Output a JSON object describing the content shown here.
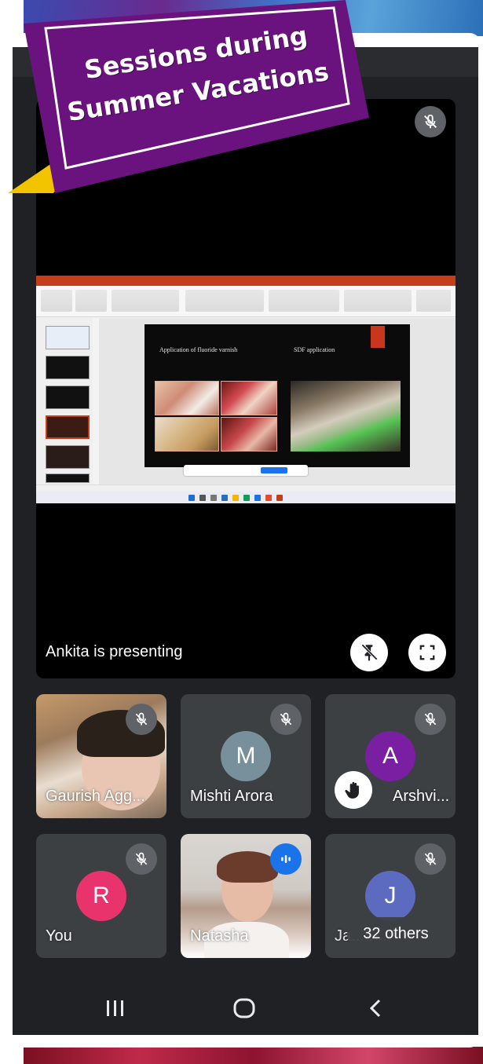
{
  "banner": {
    "line1": "Sessions during",
    "line2": "Summer Vacations"
  },
  "meet": {
    "presenter_label": "Ankita is presenting",
    "buttons": {
      "mic_off": "mic-off-icon",
      "unpin": "unpin-icon",
      "fullscreen": "fullscreen-icon"
    },
    "shared_slide": {
      "title_left": "Application of fluoride varnish",
      "title_right": "SDF application"
    },
    "participants": [
      {
        "name": "Gaurish Agg...",
        "type": "video",
        "muted": true
      },
      {
        "name": "Mishti Arora",
        "initial": "M",
        "avatar_color": "#78909c",
        "muted": true
      },
      {
        "name": "Arshvi...",
        "initial": "A",
        "avatar_color": "#7b1fa2",
        "muted": true,
        "hand_raised": true
      },
      {
        "name": "You",
        "initial": "R",
        "avatar_color": "#e8336d",
        "muted": true
      },
      {
        "name": "Natasha",
        "type": "video",
        "speaking": true
      },
      {
        "name": "Ja...Si...",
        "initial": "J",
        "avatar_color": "#5c6bc0",
        "muted": true,
        "others_label": "32 others"
      }
    ]
  },
  "colors": {
    "banner_purple": "#6a137e",
    "banner_yellow": "#f2c400",
    "screen_bg": "#202124",
    "tile_bg": "#3c4043",
    "accent_blue": "#1a73e8"
  },
  "navigation": [
    "recent-apps-icon",
    "home-icon",
    "back-icon"
  ]
}
